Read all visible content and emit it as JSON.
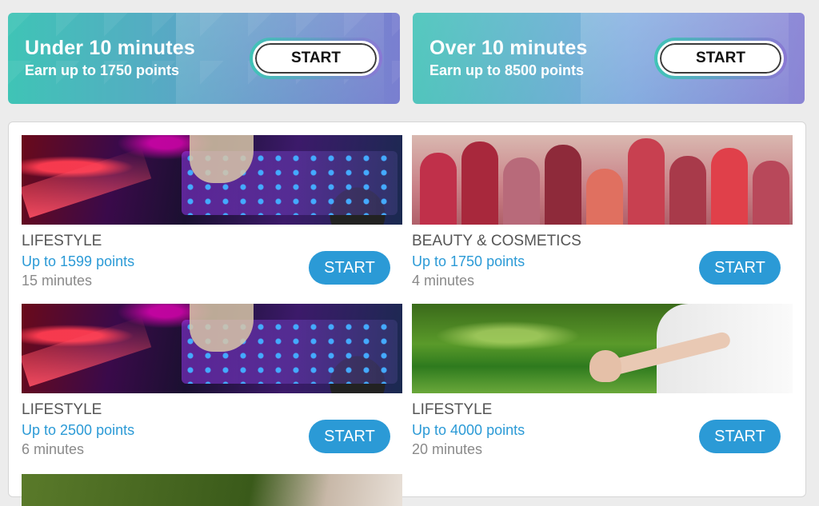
{
  "banners": [
    {
      "title": "Under 10 minutes",
      "subtitle": "Earn up to 1750 points",
      "button": "START"
    },
    {
      "title": "Over 10 minutes",
      "subtitle": "Earn up to 8500 points",
      "button": "START"
    }
  ],
  "surveys": [
    {
      "category": "LIFESTYLE",
      "points": "Up to 1599 points",
      "duration": "15 minutes",
      "button": "START",
      "image": "dj-turntable"
    },
    {
      "category": "BEAUTY & COSMETICS",
      "points": "Up to 1750 points",
      "duration": "4 minutes",
      "button": "START",
      "image": "lipsticks"
    },
    {
      "category": "LIFESTYLE",
      "points": "Up to 2500 points",
      "duration": "6 minutes",
      "button": "START",
      "image": "dj-turntable"
    },
    {
      "category": "LIFESTYLE",
      "points": "Up to 4000 points",
      "duration": "20 minutes",
      "button": "START",
      "image": "yoga-hand"
    }
  ],
  "colors": {
    "accent_blue": "#2b9ad6",
    "banner_teal": "#3fc4b6",
    "banner_purple": "#8a78d4"
  }
}
